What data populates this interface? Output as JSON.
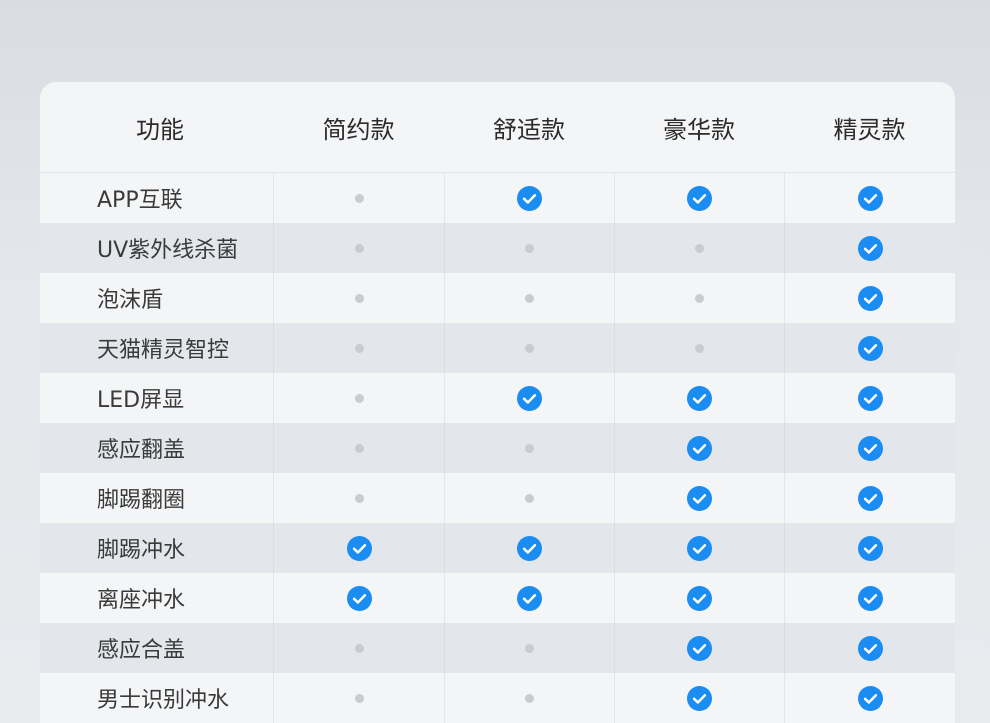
{
  "table": {
    "header": {
      "feature": "功能",
      "columns": [
        "简约款",
        "舒适款",
        "豪华款",
        "精灵款"
      ]
    },
    "rows": [
      {
        "label": "APP互联",
        "values": [
          false,
          true,
          true,
          true
        ]
      },
      {
        "label": "UV紫外线杀菌",
        "values": [
          false,
          false,
          false,
          true
        ]
      },
      {
        "label": "泡沫盾",
        "values": [
          false,
          false,
          false,
          true
        ]
      },
      {
        "label": "天猫精灵智控",
        "values": [
          false,
          false,
          false,
          true
        ]
      },
      {
        "label": "LED屏显",
        "values": [
          false,
          true,
          true,
          true
        ]
      },
      {
        "label": "感应翻盖",
        "values": [
          false,
          false,
          true,
          true
        ]
      },
      {
        "label": "脚踢翻圈",
        "values": [
          false,
          false,
          true,
          true
        ]
      },
      {
        "label": "脚踢冲水",
        "values": [
          true,
          true,
          true,
          true
        ]
      },
      {
        "label": "离座冲水",
        "values": [
          true,
          true,
          true,
          true
        ]
      },
      {
        "label": "感应合盖",
        "values": [
          false,
          false,
          true,
          true
        ]
      },
      {
        "label": "男士识别冲水",
        "values": [
          false,
          false,
          true,
          true
        ]
      }
    ],
    "icons": {
      "yes": "check-circle-icon",
      "no": "dot-icon"
    },
    "colors": {
      "check": "#1a8cf2",
      "dot": "#c8cbd0"
    }
  }
}
